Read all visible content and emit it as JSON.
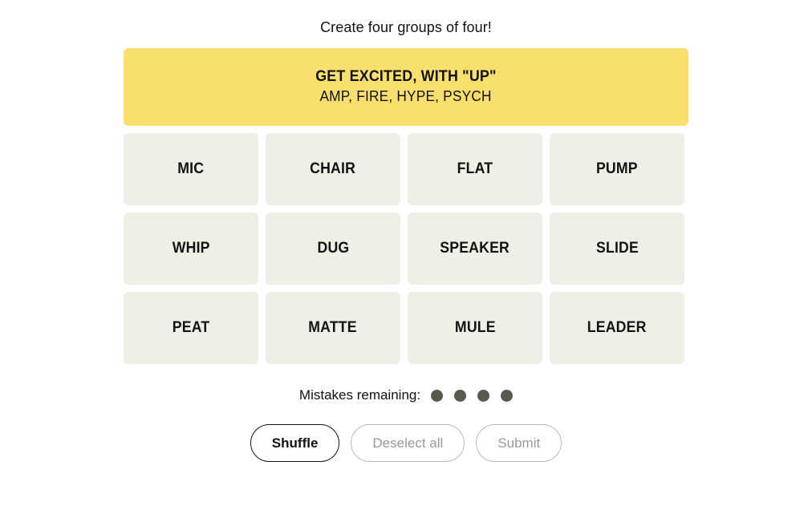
{
  "page": {
    "title": "Create four groups of four!",
    "background_color": "#ffffff"
  },
  "board": {
    "solved_groups": [
      {
        "title": "GET EXCITED, WITH \"UP\"",
        "members_text": "AMP, FIRE, HYPE, PSYCH",
        "members": [
          "AMP",
          "FIRE",
          "HYPE",
          "PSYCH"
        ],
        "color": "#f9df6d",
        "difficulty": "yellow"
      }
    ],
    "tile_color": "#efefe6",
    "rows": [
      [
        {
          "label": "MIC",
          "selected": false
        },
        {
          "label": "CHAIR",
          "selected": false
        },
        {
          "label": "FLAT",
          "selected": false
        },
        {
          "label": "PUMP",
          "selected": false
        }
      ],
      [
        {
          "label": "WHIP",
          "selected": false
        },
        {
          "label": "DUG",
          "selected": false
        },
        {
          "label": "SPEAKER",
          "selected": false
        },
        {
          "label": "SLIDE",
          "selected": false
        }
      ],
      [
        {
          "label": "PEAT",
          "selected": false
        },
        {
          "label": "MATTE",
          "selected": false
        },
        {
          "label": "MULE",
          "selected": false
        },
        {
          "label": "LEADER",
          "selected": false
        }
      ]
    ]
  },
  "mistakes": {
    "label": "Mistakes remaining:",
    "remaining": 4,
    "total": 4,
    "dot_color": "#5a594e"
  },
  "actions": {
    "buttons": [
      {
        "label": "Shuffle",
        "name": "shuffle-button",
        "state": "enabled"
      },
      {
        "label": "Deselect all",
        "name": "deselect-all-button",
        "state": "disabled"
      },
      {
        "label": "Submit",
        "name": "submit-button",
        "state": "disabled"
      }
    ]
  }
}
